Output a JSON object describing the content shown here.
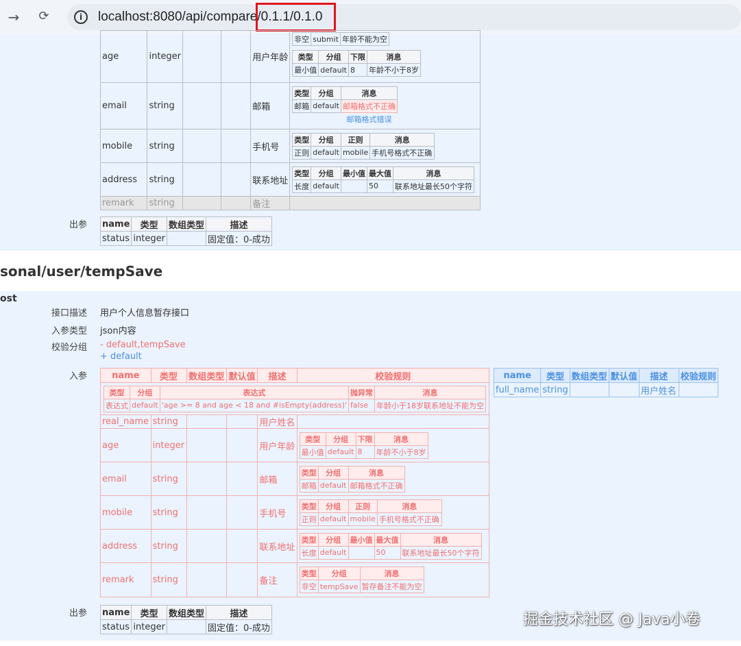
{
  "browser": {
    "url": "localhost:8080/api/compare/0.1.1/0.1.0",
    "nav_back": "←",
    "nav_forward": "→",
    "nav_reload": "⟳"
  },
  "section1": {
    "rows": [
      {
        "name": "age",
        "type": "integer",
        "desc": "用户年龄",
        "prev": {
          "c1": "非空",
          "c2": "submit",
          "c3": "年龄不能为空"
        },
        "rule_headers": [
          "类型",
          "分组",
          "下限",
          "消息"
        ],
        "rule": [
          "最小值",
          "default",
          "8",
          "年龄不小于8岁"
        ]
      },
      {
        "name": "email",
        "type": "string",
        "desc": "邮箱",
        "rule_headers": [
          "类型",
          "分组",
          "消息"
        ],
        "rule": [
          "邮箱",
          "default",
          "邮箱格式不正确"
        ],
        "rule_alt": "邮箱格式错误"
      },
      {
        "name": "mobile",
        "type": "string",
        "desc": "手机号",
        "rule_headers": [
          "类型",
          "分组",
          "正则",
          "消息"
        ],
        "rule": [
          "正则",
          "default",
          "mobile",
          "手机号格式不正确"
        ]
      },
      {
        "name": "address",
        "type": "string",
        "desc": "联系地址",
        "rule_headers": [
          "类型",
          "分组",
          "最小值",
          "最大值",
          "消息"
        ],
        "rule": [
          "长度",
          "default",
          "",
          "50",
          "联系地址最长50个字符"
        ]
      },
      {
        "name": "remark",
        "type": "string",
        "desc": "备注"
      }
    ],
    "output_label": "出参",
    "output_headers": [
      "name",
      "类型",
      "数组类型",
      "描述"
    ],
    "output_row": [
      "status",
      "integer",
      "",
      "固定值：0-成功"
    ]
  },
  "section2": {
    "path": "sonal/user/tempSave",
    "method": "ost",
    "desc_label": "接口描述",
    "desc_value": "用户个人信息暂存接口",
    "input_type_label": "入参类型",
    "input_type_value": "json内容",
    "group_label": "校验分组",
    "group_removed": "- default,tempSave",
    "group_added": "+ default",
    "input_label": "入参",
    "removed_table": {
      "headers": [
        "name",
        "类型",
        "数组类型",
        "默认值",
        "描述",
        "校验规则"
      ],
      "class_rule_headers": [
        "类型",
        "分组",
        "表达式",
        "抛异常",
        "消息"
      ],
      "class_rule": [
        "表达式",
        "default",
        "'age >= 8 and age < 18 and #isEmpty(address)'",
        "false",
        "年龄小于18岁联系地址不能为空"
      ],
      "rows": [
        {
          "name": "real_name",
          "type": "string",
          "desc": "用户姓名"
        },
        {
          "name": "age",
          "type": "integer",
          "desc": "用户年龄",
          "rule_headers": [
            "类型",
            "分组",
            "下限",
            "消息"
          ],
          "rule": [
            "最小值",
            "default",
            "8",
            "年龄不小于8岁"
          ]
        },
        {
          "name": "email",
          "type": "string",
          "desc": "邮箱",
          "rule_headers": [
            "类型",
            "分组",
            "消息"
          ],
          "rule": [
            "邮箱",
            "default",
            "邮箱格式不正确"
          ]
        },
        {
          "name": "mobile",
          "type": "string",
          "desc": "手机号",
          "rule_headers": [
            "类型",
            "分组",
            "正则",
            "消息"
          ],
          "rule": [
            "正则",
            "default",
            "mobile",
            "手机号格式不正确"
          ]
        },
        {
          "name": "address",
          "type": "string",
          "desc": "联系地址",
          "rule_headers": [
            "类型",
            "分组",
            "最小值",
            "最大值",
            "消息"
          ],
          "rule": [
            "长度",
            "default",
            "",
            "50",
            "联系地址最长50个字符"
          ]
        },
        {
          "name": "remark",
          "type": "string",
          "desc": "备注",
          "rule_headers": [
            "类型",
            "分组",
            "消息"
          ],
          "rule": [
            "非空",
            "tempSave",
            "暂存备注不能为空"
          ]
        }
      ]
    },
    "added_table": {
      "headers": [
        "name",
        "类型",
        "数组类型",
        "默认值",
        "描述",
        "校验规则"
      ],
      "row": [
        "full_name",
        "string",
        "",
        "",
        "用户姓名",
        ""
      ]
    },
    "output_label": "出参",
    "output_headers": [
      "name",
      "类型",
      "数组类型",
      "描述"
    ],
    "output_row": [
      "status",
      "integer",
      "",
      "固定值：0-成功"
    ]
  },
  "watermark": "掘金技术社区 @ Java小卷",
  "colors": {
    "removed": "#f07070",
    "added": "#4a90e2",
    "band": "#eaf3fe",
    "highlight": "#e0141e"
  }
}
